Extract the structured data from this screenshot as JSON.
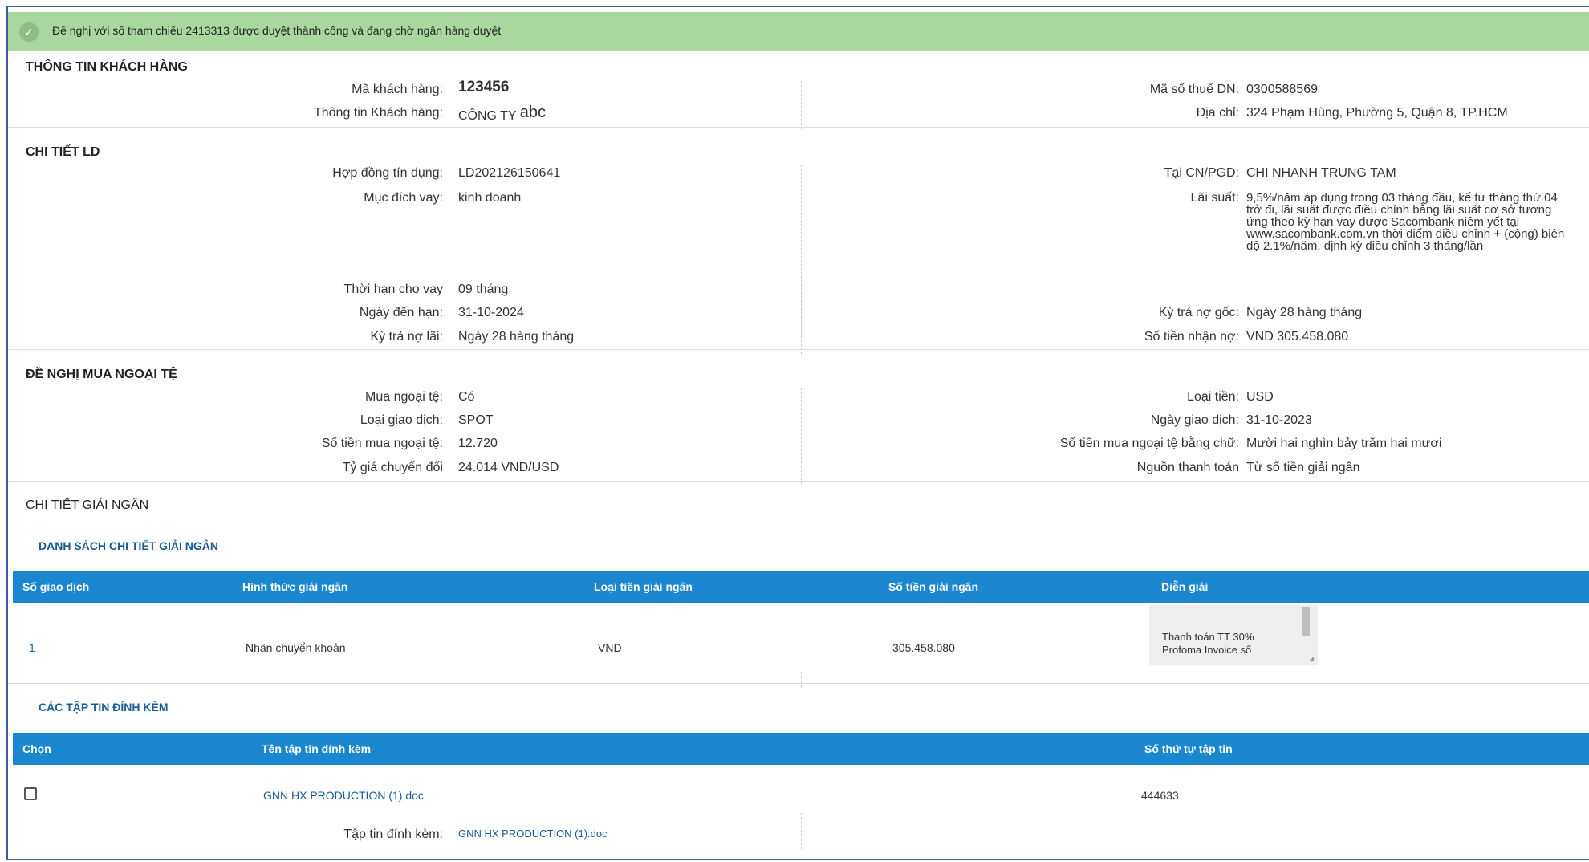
{
  "notice": {
    "icon": "check-circle-icon",
    "message": "Đề nghị với số tham chiếu 2413313 được duyệt thành công và đang chờ ngân hàng duyệt"
  },
  "customer": {
    "title": "THÔNG TIN KHÁCH HÀNG",
    "code_label": "Mã khách hàng:",
    "code_value": "123456",
    "info_label": "Thông tin Khách hàng:",
    "info_value_prefix": "CÔNG TY",
    "info_value_suffix": "abc",
    "tax_label": "Mã số thuế DN:",
    "tax_value": "0300588569",
    "address_label": "Địa chỉ:",
    "address_value": "324 Phạm Hùng, Phường 5, Quận 8, TP.HCM"
  },
  "loan": {
    "title": "CHI TIẾT LD",
    "contract_label": "Hợp đồng tín dụng:",
    "contract_value": "LD202126150641",
    "purpose_label": "Mục đích vay:",
    "purpose_value": "kinh doanh",
    "term_label": "Thời hạn cho vay",
    "term_value": "09 tháng",
    "due_label": "Ngày đến hạn:",
    "due_value": "31-10-2024",
    "interest_period_label": "Kỳ trả nợ lãi:",
    "interest_period_value": "Ngày 28 hàng tháng",
    "branch_label": "Tại CN/PGD:",
    "branch_value": "CHI NHANH TRUNG TAM",
    "rate_label": "Lãi suất:",
    "rate_value": "9,5%/năm áp dụng trong 03 tháng đầu, kể từ tháng thứ 04 trở đi, lãi suất được điều chỉnh bằng lãi suất cơ sở tương ứng theo kỳ hạn vay được Sacombank niêm yết tại www.sacombank.com.vn thời điểm điều chỉnh + (cộng) biên độ 2.1%/năm, định kỳ điều chỉnh 3 tháng/lần",
    "principal_period_label": "Kỳ trả nợ gốc:",
    "principal_period_value": "Ngày 28 hàng tháng",
    "amount_label": "Số tiền nhận nợ:",
    "amount_value": "VND  305.458.080"
  },
  "fx": {
    "title": "ĐỀ NGHỊ MUA NGOẠI TỆ",
    "buy_label": "Mua ngoại tệ:",
    "buy_value": "Có",
    "type_label": "Loại giao dịch:",
    "type_value": "SPOT",
    "amount_label": "Số tiền mua ngoại tệ:",
    "amount_value": "12.720",
    "rate_label": "Tỷ giá chuyển đổi",
    "rate_value": "24.014 VND/USD",
    "currency_label": "Loại tiền:",
    "currency_value": "USD",
    "date_label": "Ngày giao dịch:",
    "date_value": "31-10-2023",
    "words_label": "Số tiền mua ngoại tệ bằng chữ:",
    "words_value": "Mười hai nghìn bảy trăm hai mươi",
    "source_label": "Nguồn thanh toán",
    "source_value": "Từ số tiền giải ngân"
  },
  "disbursement": {
    "title": "CHI TIẾT GIẢI NGÂN",
    "list_title": "DANH SÁCH CHI TIẾT GIẢI NGÂN",
    "headers": [
      "Số giao dịch",
      "Hình thức giải ngân",
      "Loại tiền giải ngân",
      "Số tiền giải ngân",
      "Diễn giải"
    ],
    "rows": [
      {
        "no": "1",
        "method": "Nhận chuyển khoản",
        "currency": "VND",
        "amount": "305.458.080",
        "desc": "Thanh toán TT 30% Profoma Invoice số"
      }
    ]
  },
  "attachments": {
    "title": "CÁC TẬP TIN ĐÍNH KÈM",
    "headers": [
      "Chọn",
      "Tên tập tin đính kèm",
      "Số thứ tự tập tin"
    ],
    "rows": [
      {
        "checked": false,
        "name": "GNN HX PRODUCTION (1).doc",
        "seq": "444633"
      }
    ],
    "attached_label": "Tập tin đính kèm:",
    "attached_value": "GNN HX PRODUCTION (1).doc"
  }
}
